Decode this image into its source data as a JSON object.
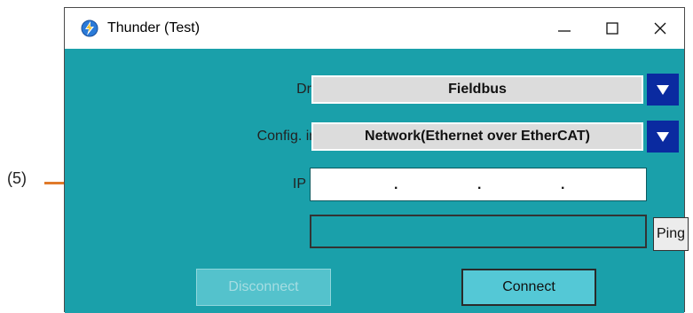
{
  "window": {
    "title": "Thunder (Test)",
    "controls": {
      "minimize": "—",
      "maximize": "☐",
      "close": "✕"
    }
  },
  "form": {
    "drive_type_label": "Drive type :",
    "drive_type_value": "Fieldbus",
    "config_interface_label": "Config. interface :",
    "config_interface_value": "Network(Ethernet over EtherCAT)",
    "ip_address_label": "IP address :",
    "ip_separator": ".",
    "status_text": "",
    "ping_label": "Ping"
  },
  "buttons": {
    "disconnect_label": "Disconnect",
    "connect_label": "Connect"
  },
  "annotation": {
    "callout_label": "(5)"
  },
  "colors": {
    "client_bg": "#1aa0aa",
    "dropdown_arrow": "#0a2aa0",
    "callout_line": "#e07a2a"
  },
  "icons": {
    "app": "thunder-app-icon",
    "dropdown": "triangle-down-icon"
  }
}
